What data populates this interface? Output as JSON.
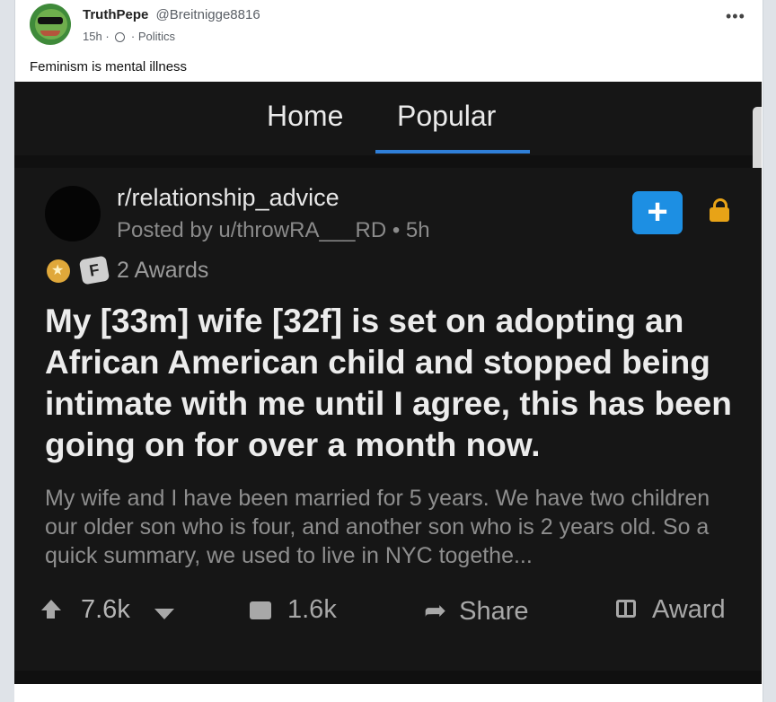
{
  "post": {
    "author_name": "TruthPepe",
    "author_handle": "@Breitnigge8816",
    "time": "15h",
    "category": "Politics",
    "text": "Feminism is mental illness",
    "more_label": "•••"
  },
  "screenshot": {
    "tabs": {
      "home": "Home",
      "popular": "Popular"
    },
    "subreddit": "r/relationship_advice",
    "posted_by": "Posted by u/throwRA___RD • 5h",
    "join_label": "+",
    "awards_label": "2 Awards",
    "award_icon_letter": "F",
    "title": "My [33m] wife [32f] is set on adopting an African American child and stopped being intimate with me until I agree, this has been going on for over a month now.",
    "excerpt": "My wife and I have been married for 5 years. We have two children our older son who is four, and another son who is 2 years old. So a quick summary, we used to live in NYC togethe...",
    "votes": "7.6k",
    "comments": "1.6k",
    "share_label": "Share",
    "award_label": "Award",
    "accent_color": "#1d8fe3"
  }
}
